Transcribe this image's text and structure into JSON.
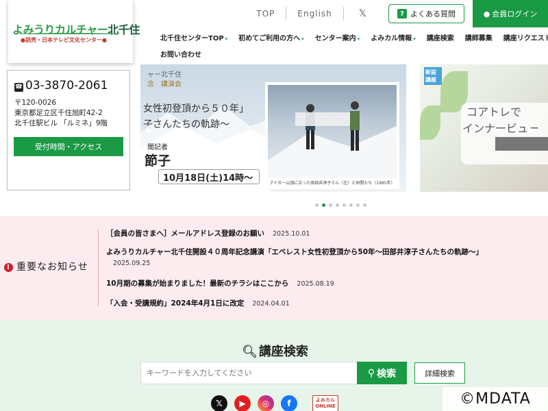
{
  "header": {
    "logo_main_a": "よみうりカルチャー",
    "logo_main_b": "北千住",
    "logo_sub": "●読売・日本テレビ文化センター●",
    "top_links": [
      "TOP",
      "English"
    ],
    "faq_label": "よくある質問",
    "login_label": "会員ログイン"
  },
  "nav": {
    "row1": [
      {
        "label": "北千住センターTOP",
        "caret": true
      },
      {
        "label": "初めてご利用の方へ",
        "caret": true
      },
      {
        "label": "センター案内",
        "caret": true
      },
      {
        "label": "よみカル情報",
        "caret": true
      },
      {
        "label": "講座検索",
        "caret": false
      },
      {
        "label": "講師募集",
        "caret": false
      },
      {
        "label": "講座リクエスト",
        "caret": false
      }
    ],
    "row2": [
      {
        "label": "お問い合わせ",
        "caret": false
      }
    ]
  },
  "contact": {
    "phone": "03-3870-2061",
    "postal": "〒120-0026",
    "address1": "東京都足立区千住旭町42-2",
    "address2": "北千住駅ビル 「ルミネ」9階",
    "access_button": "受付時間・アクセス"
  },
  "slider": {
    "main": {
      "text1": "ャー北千住",
      "text2": "念　講演会",
      "title1": "女性初登頂から５０年」",
      "title2": "子さんたちの軌跡～",
      "name1": "聞記者",
      "name2": "節子",
      "date": "10月18日(土)14時～",
      "photo_caption": "アイガー山頂に立った田部井淳子さん（左）と仲間たち（1985年）"
    },
    "side": {
      "badge": "新設講座",
      "line1": "コアトレで",
      "line2": "インナービュー"
    },
    "dot_count": 8,
    "active_dot": 1
  },
  "notice": {
    "heading": "重要なお知らせ",
    "items": [
      {
        "title": "［会員の皆さまへ］メールアドレス登録のお願い",
        "date": "2025.10.01",
        "wrap": false
      },
      {
        "title": "よみうりカルチャー北千住開設４０周年記念講演「エベレスト女性初登頂から50年～田部井淳子さんたちの軌跡～」",
        "date": "2025.09.25",
        "wrap": true
      },
      {
        "title": "10月期の募集が始まりました！最新のチラシはここから",
        "date": "2025.08.19",
        "wrap": false
      },
      {
        "title": "「入会・受講規約」2024年4月1日に改定",
        "date": "2024.04.01",
        "wrap": false
      }
    ]
  },
  "search": {
    "title": "講座検索",
    "placeholder": "キーワードを入力してください",
    "search_button": "検索",
    "detail_button": "詳細検索"
  },
  "social": {
    "yomikaru_line1": "よみカル",
    "yomikaru_line2": "ONLINE"
  },
  "watermark": "©MDATA",
  "colors": {
    "brand_green": "#1a9a45",
    "notice_bg": "#fdecef",
    "search_bg": "#e7f4ea",
    "warning_red": "#cc1f2d"
  }
}
